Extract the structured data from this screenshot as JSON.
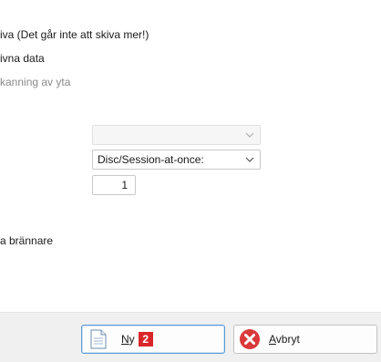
{
  "options": [
    {
      "text": "iva (Det går inte att skiva mer!)",
      "disabled": false
    },
    {
      "text": "ivna data",
      "disabled": false
    },
    {
      "text": "kanning av yta",
      "disabled": true
    }
  ],
  "combo_empty": {
    "value": ""
  },
  "write_mode": {
    "value": "Disc/Session-at-once:"
  },
  "copies": {
    "value": "1"
  },
  "burner_option": {
    "text": "a brännare"
  },
  "buttons": {
    "new": {
      "label_underline": "N",
      "label_rest": "y",
      "badge": "2"
    },
    "cancel": {
      "label_underline": "A",
      "label_rest": "vbryt"
    }
  },
  "icons": {
    "new": "document-icon",
    "cancel": "cancel-x-icon"
  },
  "colors": {
    "badge": "#d9262b",
    "cancel_icon": "#d9393a",
    "primary_border": "#5b9bd5"
  }
}
